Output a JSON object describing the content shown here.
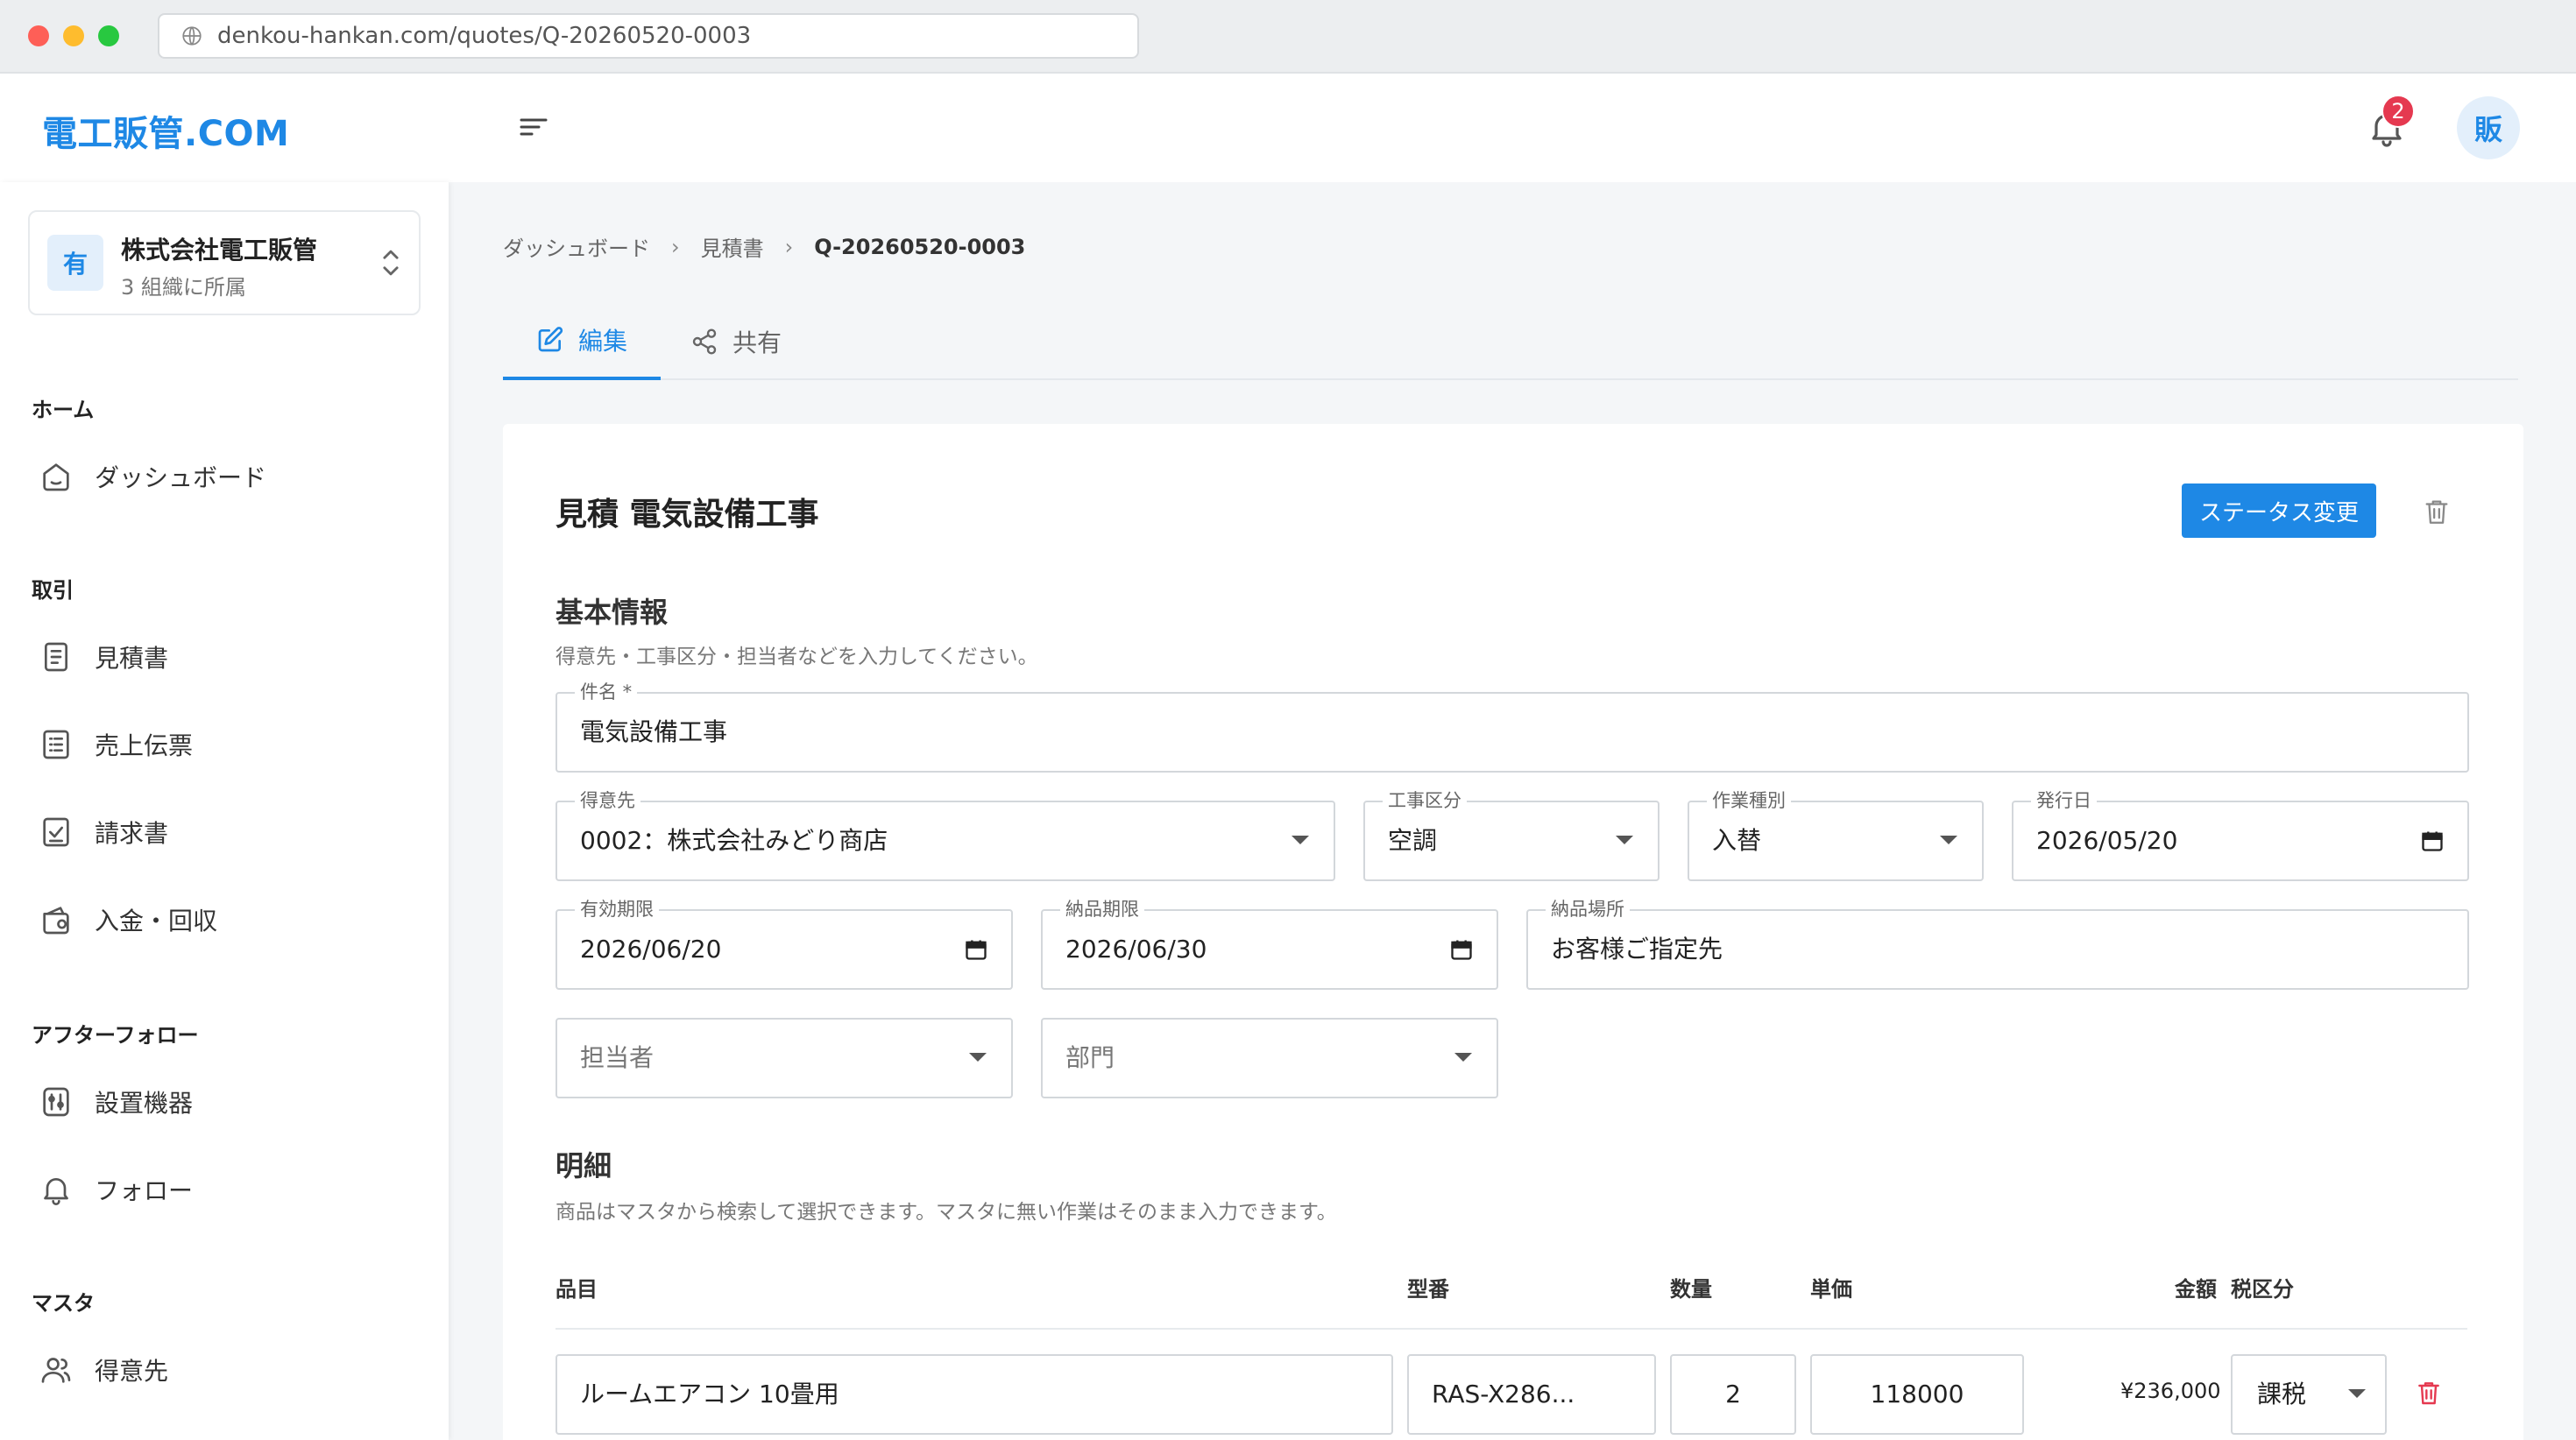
{
  "browser": {
    "url": "denkou-hankan.com/quotes/Q-20260520-0003"
  },
  "header": {
    "logo": "電工販管.COM",
    "notification_count": "2",
    "avatar_initial": "販"
  },
  "sidebar": {
    "org": {
      "icon_initial": "有",
      "name": "株式会社電工販管",
      "subtitle": "3 組織に所属"
    },
    "sections": [
      {
        "title": "ホーム",
        "items": [
          {
            "label": "ダッシュボード",
            "icon": "dashboard-icon"
          }
        ]
      },
      {
        "title": "取引",
        "items": [
          {
            "label": "見積書",
            "icon": "document-icon"
          },
          {
            "label": "売上伝票",
            "icon": "list-icon"
          },
          {
            "label": "請求書",
            "icon": "invoice-check-icon"
          },
          {
            "label": "入金・回収",
            "icon": "wallet-icon"
          }
        ]
      },
      {
        "title": "アフターフォロー",
        "items": [
          {
            "label": "設置機器",
            "icon": "device-icon"
          },
          {
            "label": "フォロー",
            "icon": "bell-icon"
          }
        ]
      },
      {
        "title": "マスタ",
        "items": [
          {
            "label": "得意先",
            "icon": "users-icon"
          }
        ]
      }
    ]
  },
  "breadcrumb": {
    "items": [
      "ダッシュボード",
      "見積書"
    ],
    "current": "Q-20260520-0003"
  },
  "tabs": {
    "edit": "編集",
    "share": "共有"
  },
  "card": {
    "title": "見積 電気設備工事",
    "status_button": "ステータス変更"
  },
  "basic_info": {
    "heading": "基本情報",
    "description": "得意先・工事区分・担当者などを入力してください。",
    "subject": {
      "label": "件名 *",
      "value": "電気設備工事"
    },
    "customer": {
      "label": "得意先",
      "value": "0002：株式会社みどり商店"
    },
    "work_category": {
      "label": "工事区分",
      "value": "空調"
    },
    "work_type": {
      "label": "作業種別",
      "value": "入替"
    },
    "issue_date": {
      "label": "発行日",
      "value": "2026/05/20"
    },
    "valid_until": {
      "label": "有効期限",
      "value": "2026/06/20"
    },
    "delivery_deadline": {
      "label": "納品期限",
      "value": "2026/06/30"
    },
    "delivery_place": {
      "label": "納品場所",
      "value": "お客様ご指定先"
    },
    "staff": {
      "placeholder": "担当者"
    },
    "department": {
      "placeholder": "部門"
    }
  },
  "details": {
    "heading": "明細",
    "description": "商品はマスタから検索して選択できます。マスタに無い作業はそのまま入力できます。",
    "columns": {
      "item": "品目",
      "model": "型番",
      "quantity": "数量",
      "unit_price": "単価",
      "amount": "金額",
      "tax": "税区分"
    },
    "rows": [
      {
        "item": "ルームエアコン 10畳用",
        "model": "RAS-X286...",
        "quantity": "2",
        "unit_price": "118000",
        "amount": "¥236,000",
        "tax": "課税"
      }
    ]
  },
  "colors": {
    "accent": "#1e88e5",
    "danger": "#e53950"
  }
}
